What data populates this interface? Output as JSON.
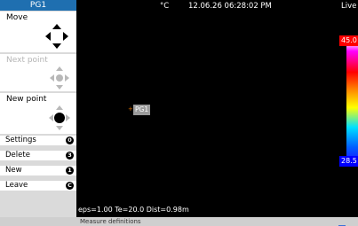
{
  "sidebar": {
    "title": "PG1",
    "panels": [
      {
        "label": "Move",
        "state": "active"
      },
      {
        "label": "Next point",
        "state": "disabled"
      },
      {
        "label": "New point",
        "state": "active"
      }
    ],
    "menu": [
      {
        "label": "Settings",
        "key": "0"
      },
      {
        "label": "Delete",
        "key": "3"
      },
      {
        "label": "New",
        "key": "1"
      },
      {
        "label": "Leave",
        "key": "C"
      }
    ]
  },
  "viewer": {
    "unit": "°C",
    "datetime": "12.06.26 06:28:02 PM",
    "mode": "Live",
    "point_tag": "PG1",
    "scale": {
      "max": "45.0",
      "min": "28.5"
    },
    "params": "eps=1.00 Te=20.0 Dist=0.98m"
  },
  "status_bar": {
    "text": "Measure definitions"
  },
  "colors": {
    "title_bg": "#1f6fb0",
    "scale_max_bg": "#ff0000",
    "scale_min_bg": "#0000ff",
    "marker": "#d36a00"
  }
}
